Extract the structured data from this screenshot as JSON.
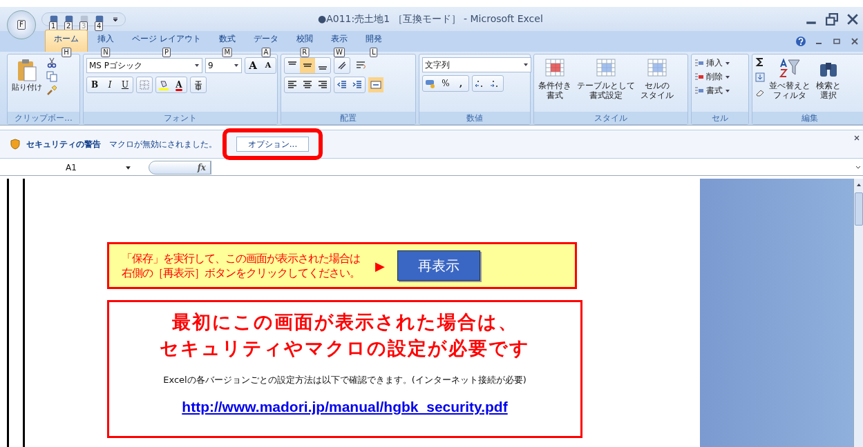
{
  "window": {
    "title": "●A011:売土地1 ［互換モード］ - Microsoft Excel"
  },
  "office_button": {
    "keytip": "F"
  },
  "quick_access": [
    {
      "keytip": "1",
      "disabled": false
    },
    {
      "keytip": "2",
      "disabled": false
    },
    {
      "keytip": "3",
      "disabled": true
    },
    {
      "keytip": "4",
      "disabled": false
    }
  ],
  "tabs": [
    {
      "label": "ホーム",
      "keytip": "H",
      "selected": true
    },
    {
      "label": "挿入",
      "keytip": "N",
      "selected": false
    },
    {
      "label": "ページ レイアウト",
      "keytip": "P",
      "selected": false
    },
    {
      "label": "数式",
      "keytip": "M",
      "selected": false
    },
    {
      "label": "データ",
      "keytip": "A",
      "selected": false
    },
    {
      "label": "校閲",
      "keytip": "R",
      "selected": false
    },
    {
      "label": "表示",
      "keytip": "W",
      "selected": false
    },
    {
      "label": "開発",
      "keytip": "L",
      "selected": false
    }
  ],
  "ribbon": {
    "clipboard": {
      "label": "クリップボー...",
      "paste": "貼り付け"
    },
    "font": {
      "label": "フォント",
      "font_name": "MS Pゴシック",
      "font_size": "9",
      "grow": "A",
      "shrink": "A",
      "bold": "B",
      "italic": "I",
      "underline": "U",
      "font_color": "A"
    },
    "alignment": {
      "label": "配置"
    },
    "number": {
      "label": "数値",
      "format": "文字列",
      "percent": "%",
      "comma": ","
    },
    "styles": {
      "label": "スタイル",
      "buttons": [
        {
          "lines": [
            "条件付き",
            "書式"
          ]
        },
        {
          "lines": [
            "テーブルとして",
            "書式設定"
          ]
        },
        {
          "lines": [
            "セルの",
            "スタイル"
          ]
        }
      ]
    },
    "cells": {
      "label": "セル",
      "buttons": [
        "挿入",
        "削除",
        "書式"
      ]
    },
    "editing": {
      "label": "編集",
      "buttons": [
        {
          "lines": [
            "並べ替えと",
            "フィルタ"
          ]
        },
        {
          "lines": [
            "検索と",
            "選択"
          ]
        }
      ]
    }
  },
  "security_bar": {
    "title": "セキュリティの警告",
    "message": "マクロが無効にされました。",
    "button": "オプション...",
    "highlighted": true
  },
  "formula_bar": {
    "name_box": "A1",
    "fx": "fx"
  },
  "sheet": {
    "notice": {
      "lines": [
        "「保存」を実行して、この画面が表示された場合は",
        "右側の［再表示］ボタンをクリックしてください。"
      ],
      "arrow": "▶",
      "button": "再表示"
    },
    "info": {
      "heading": [
        "最初にこの画面が表示された場合は、",
        "セキュリティやマクロの設定が必要です"
      ],
      "note": "Excelの各バージョンごとの設定方法は以下で確認できます。(インターネット接続が必要)",
      "link": "http://www.madori.jp/manual/hgbk_security.pdf"
    }
  }
}
